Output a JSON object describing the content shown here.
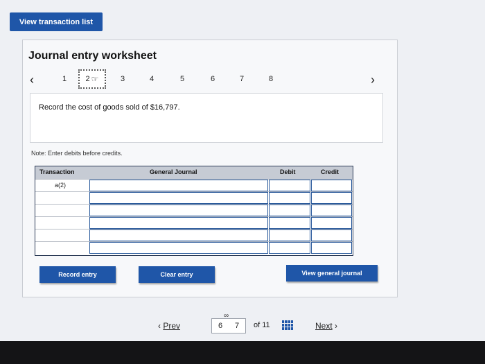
{
  "top": {
    "view_transaction_list": "View transaction list"
  },
  "worksheet": {
    "title": "Journal entry worksheet",
    "steps": [
      "1",
      "2",
      "3",
      "4",
      "5",
      "6",
      "7",
      "8"
    ],
    "active_step": "2",
    "instruction": "Record the cost of goods sold of $16,797.",
    "note": "Note: Enter debits before credits."
  },
  "table": {
    "headers": {
      "transaction": "Transaction",
      "general_journal": "General Journal",
      "debit": "Debit",
      "credit": "Credit"
    },
    "rows": [
      {
        "transaction": "a(2)",
        "account": "",
        "debit": "",
        "credit": ""
      },
      {
        "transaction": "",
        "account": "",
        "debit": "",
        "credit": ""
      },
      {
        "transaction": "",
        "account": "",
        "debit": "",
        "credit": ""
      },
      {
        "transaction": "",
        "account": "",
        "debit": "",
        "credit": ""
      },
      {
        "transaction": "",
        "account": "",
        "debit": "",
        "credit": ""
      },
      {
        "transaction": "",
        "account": "",
        "debit": "",
        "credit": ""
      }
    ]
  },
  "buttons": {
    "record_entry": "Record entry",
    "clear_entry": "Clear entry",
    "view_general_journal": "View general journal"
  },
  "pager": {
    "prev": "Prev",
    "current": "6",
    "current_alt": "7",
    "of_total": "of 11",
    "next": "Next"
  },
  "colors": {
    "accent": "#1f56a8"
  },
  "icons": {
    "prev_arrow": "chevron-left-icon",
    "next_arrow": "chevron-right-icon",
    "pointer": "hand-pointer-icon",
    "grid": "grid-icon",
    "link": "link-icon"
  }
}
